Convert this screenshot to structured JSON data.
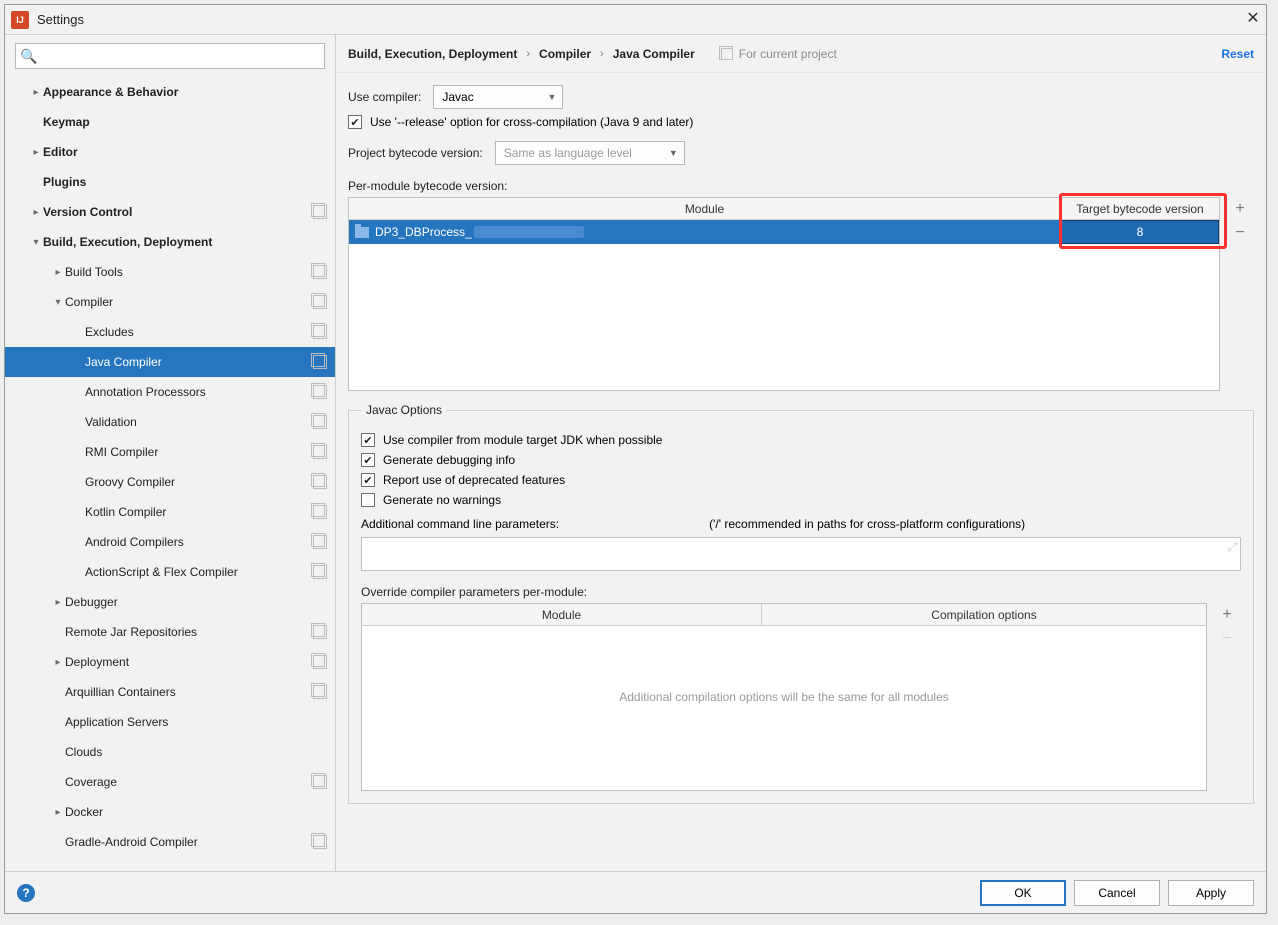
{
  "window": {
    "title": "Settings"
  },
  "search": {
    "placeholder": ""
  },
  "tree": [
    {
      "label": "Appearance & Behavior",
      "indent": 0,
      "arrow": "right",
      "bold": true
    },
    {
      "label": "Keymap",
      "indent": 0,
      "bold": true
    },
    {
      "label": "Editor",
      "indent": 0,
      "arrow": "right",
      "bold": true
    },
    {
      "label": "Plugins",
      "indent": 0,
      "bold": true
    },
    {
      "label": "Version Control",
      "indent": 0,
      "arrow": "right",
      "bold": true,
      "badge": true
    },
    {
      "label": "Build, Execution, Deployment",
      "indent": 0,
      "arrow": "down",
      "bold": true
    },
    {
      "label": "Build Tools",
      "indent": 1,
      "arrow": "right",
      "badge": true
    },
    {
      "label": "Compiler",
      "indent": 1,
      "arrow": "down",
      "badge": true
    },
    {
      "label": "Excludes",
      "indent": 2,
      "badge": true
    },
    {
      "label": "Java Compiler",
      "indent": 2,
      "badge": true,
      "selected": true
    },
    {
      "label": "Annotation Processors",
      "indent": 2,
      "badge": true
    },
    {
      "label": "Validation",
      "indent": 2,
      "badge": true
    },
    {
      "label": "RMI Compiler",
      "indent": 2,
      "badge": true
    },
    {
      "label": "Groovy Compiler",
      "indent": 2,
      "badge": true
    },
    {
      "label": "Kotlin Compiler",
      "indent": 2,
      "badge": true
    },
    {
      "label": "Android Compilers",
      "indent": 2,
      "badge": true
    },
    {
      "label": "ActionScript & Flex Compiler",
      "indent": 2,
      "badge": true
    },
    {
      "label": "Debugger",
      "indent": 1,
      "arrow": "right"
    },
    {
      "label": "Remote Jar Repositories",
      "indent": 1,
      "badge": true
    },
    {
      "label": "Deployment",
      "indent": 1,
      "arrow": "right",
      "badge": true
    },
    {
      "label": "Arquillian Containers",
      "indent": 1,
      "badge": true
    },
    {
      "label": "Application Servers",
      "indent": 1
    },
    {
      "label": "Clouds",
      "indent": 1
    },
    {
      "label": "Coverage",
      "indent": 1,
      "badge": true
    },
    {
      "label": "Docker",
      "indent": 1,
      "arrow": "right"
    },
    {
      "label": "Gradle-Android Compiler",
      "indent": 1,
      "badge": true
    }
  ],
  "crumbs": {
    "a": "Build, Execution, Deployment",
    "b": "Compiler",
    "c": "Java Compiler",
    "scope": "For current project",
    "reset": "Reset"
  },
  "main": {
    "useCompilerLabel": "Use compiler:",
    "useCompilerValue": "Javac",
    "releaseChecked": true,
    "releaseLabel": "Use '--release' option for cross-compilation (Java 9 and later)",
    "projBytecodeLabel": "Project bytecode version:",
    "projBytecodePlaceholder": "Same as language level",
    "perModuleLabel": "Per-module bytecode version:",
    "perModuleHeaders": {
      "module": "Module",
      "target": "Target bytecode version"
    },
    "perModuleRow": {
      "module": "DP3_DBProcess_",
      "target": "8"
    },
    "javacLegend": "Javac Options",
    "opt1": {
      "checked": true,
      "label": "Use compiler from module target JDK when possible"
    },
    "opt2": {
      "checked": true,
      "label": "Generate debugging info"
    },
    "opt3": {
      "checked": true,
      "label": "Report use of deprecated features"
    },
    "opt4": {
      "checked": false,
      "label": "Generate no warnings"
    },
    "addParamsLabel": "Additional command line parameters:",
    "addParamsHint": "('/' recommended in paths for cross-platform configurations)",
    "overrideLabel": "Override compiler parameters per-module:",
    "overrideHeaders": {
      "module": "Module",
      "opts": "Compilation options"
    },
    "overrideEmpty": "Additional compilation options will be the same for all modules"
  },
  "footer": {
    "ok": "OK",
    "cancel": "Cancel",
    "apply": "Apply"
  }
}
